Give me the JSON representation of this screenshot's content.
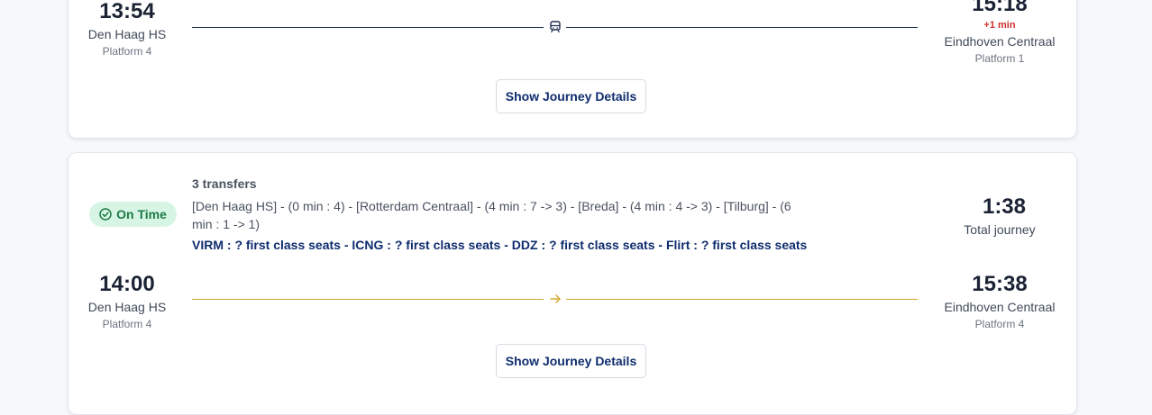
{
  "journey1": {
    "departure_time": "13:54",
    "departure_station": "Den Haag HS",
    "departure_platform": "Platform 4",
    "arrival_time": "15:18",
    "arrival_delay": "+1 min",
    "arrival_station": "Eindhoven Centraal",
    "arrival_platform": "Platform 1",
    "details_button": "Show Journey Details"
  },
  "journey2": {
    "status": "On Time",
    "transfers": "3 transfers",
    "route": "[Den Haag HS] - (0 min : 4) - [Rotterdam Centraal] - (4 min : 7 -> 3) - [Breda] - (4 min : 4 -> 3) - [Tilburg] - (6 min : 1 -> 1)",
    "seats": "VIRM : ? first class seats - ICNG : ? first class seats - DDZ : ? first class seats - Flirt : ? first class seats",
    "duration": "1:38",
    "duration_label": "Total journey",
    "departure_time": "14:00",
    "departure_station": "Den Haag HS",
    "departure_platform": "Platform 4",
    "arrival_time": "15:38",
    "arrival_station": "Eindhoven Centraal",
    "arrival_platform": "Platform 4",
    "details_button": "Show Journey Details"
  },
  "colors": {
    "on_time_bg": "#d7f5e4",
    "on_time_text": "#1e7a46",
    "delay": "#d0312d",
    "accent_navy": "#0f2d6e",
    "transfer_line": "#d4a82a"
  },
  "icons": {
    "journey1_mode": "train-icon",
    "journey2_mode": "arrow-right-icon",
    "status": "check-circle-icon"
  }
}
